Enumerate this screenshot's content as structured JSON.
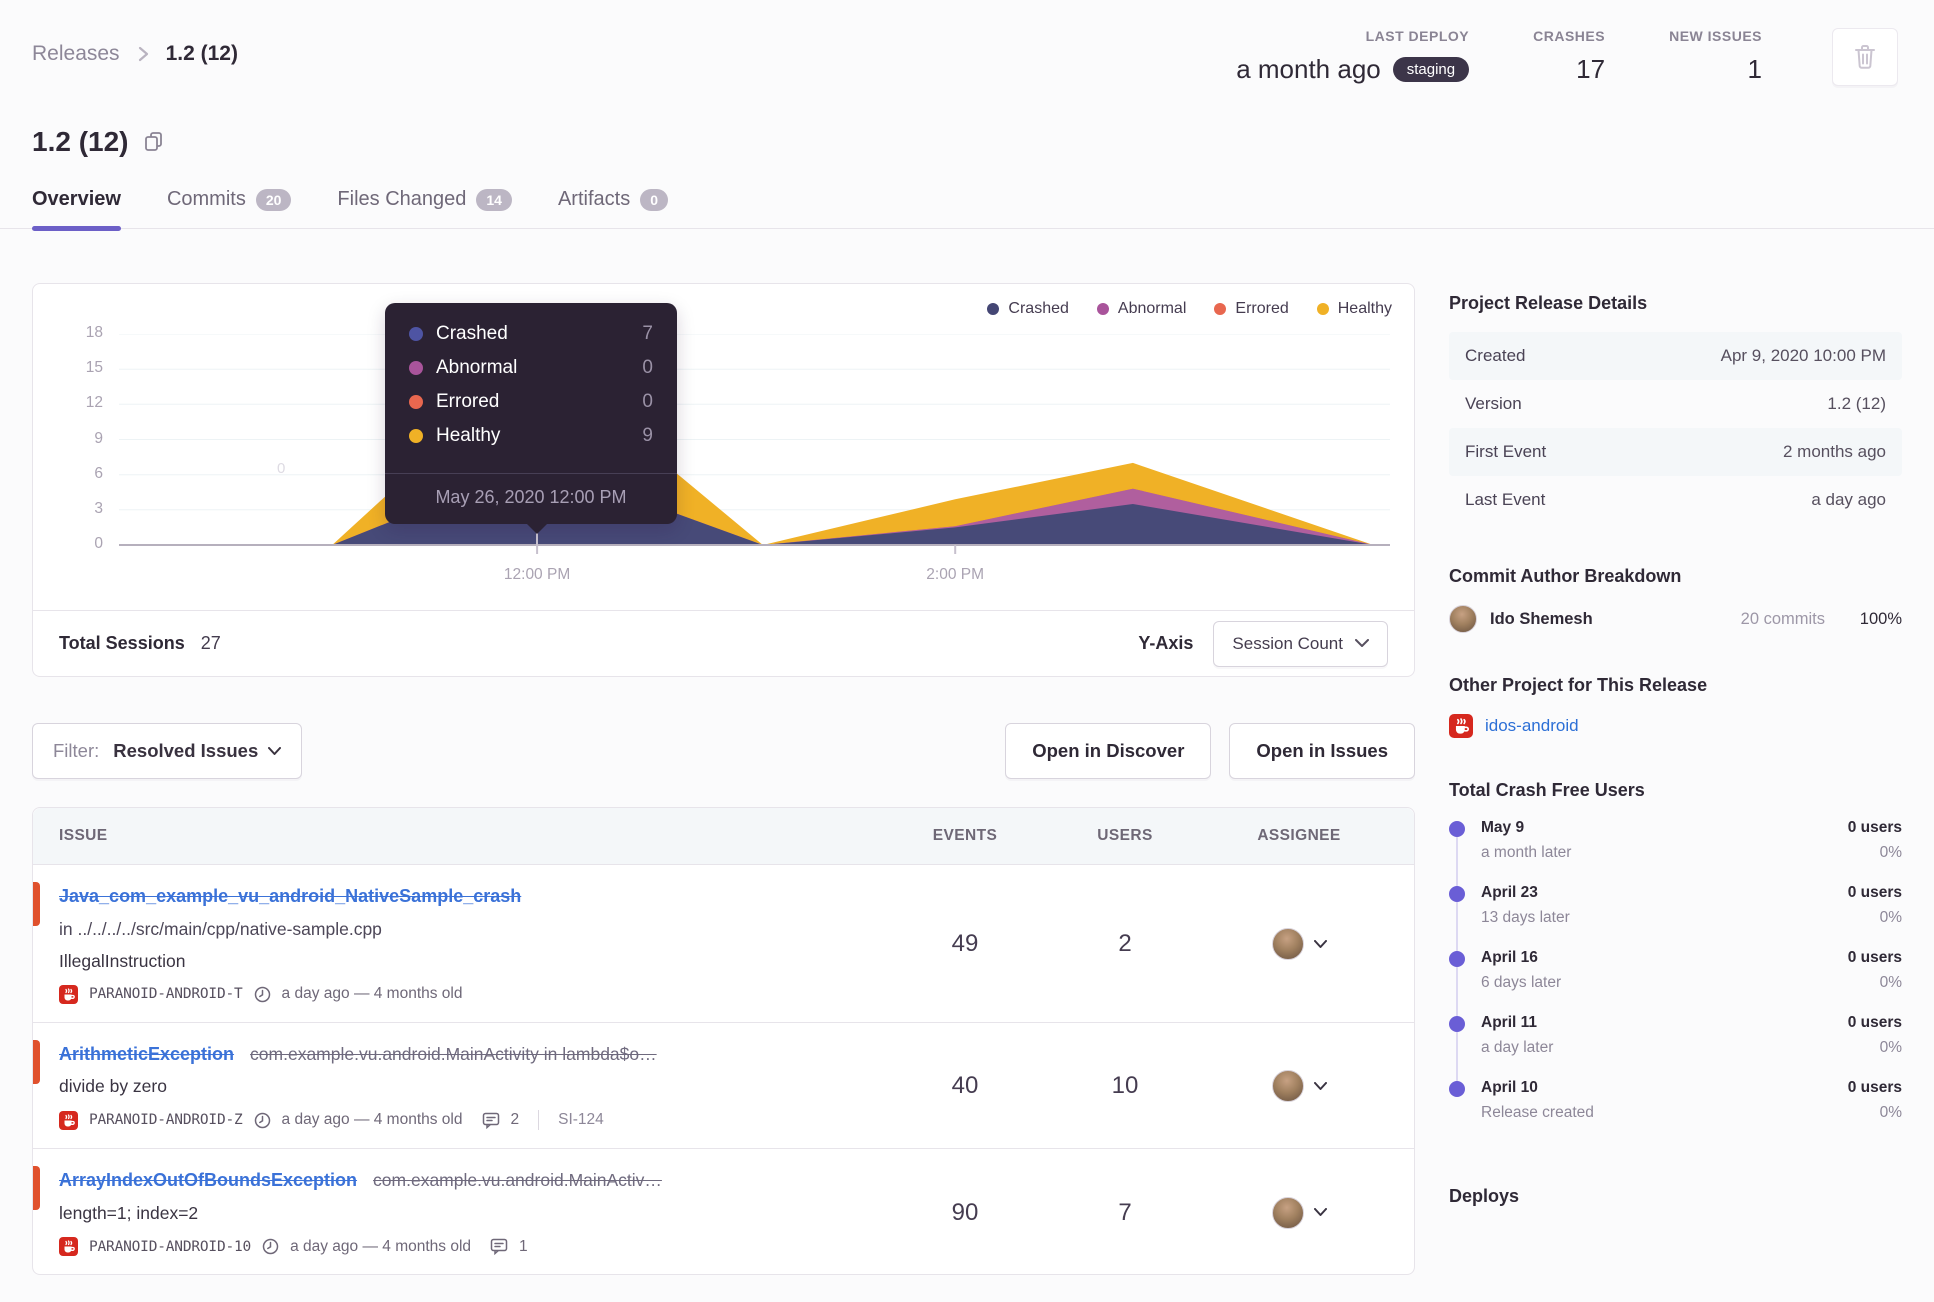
{
  "colors": {
    "accent_purple": "#6c5fc7",
    "crashed": "#444674",
    "abnormal": "#a9549b",
    "errored": "#e8674f",
    "healthy": "#f0b126",
    "error_level_bar": "#e0512d",
    "link_blue": "#3b72d8"
  },
  "breadcrumb": {
    "parent": "Releases",
    "current": "1.2 (12)"
  },
  "header": {
    "title": "1.2 (12)",
    "stats": [
      {
        "label": "LAST DEPLOY",
        "value": "a month ago",
        "badge": "staging"
      },
      {
        "label": "CRASHES",
        "value": "17"
      },
      {
        "label": "NEW ISSUES",
        "value": "1"
      }
    ]
  },
  "tabs": [
    {
      "label": "Overview"
    },
    {
      "label": "Commits",
      "badge": "20"
    },
    {
      "label": "Files Changed",
      "badge": "14"
    },
    {
      "label": "Artifacts",
      "badge": "0"
    }
  ],
  "chart": {
    "legend": [
      {
        "label": "Crashed",
        "color": "#444674"
      },
      {
        "label": "Abnormal",
        "color": "#a9549b"
      },
      {
        "label": "Errored",
        "color": "#e8674f"
      },
      {
        "label": "Healthy",
        "color": "#f0b126"
      }
    ],
    "tooltip": {
      "rows": [
        {
          "label": "Crashed",
          "value": "7",
          "color": "#4e54a3"
        },
        {
          "label": "Abnormal",
          "value": "0",
          "color": "#a9549b"
        },
        {
          "label": "Errored",
          "value": "0",
          "color": "#e8674f"
        },
        {
          "label": "Healthy",
          "value": "9",
          "color": "#f0b126"
        }
      ],
      "footer": "May 26, 2020 12:00 PM"
    },
    "y_ticks": [
      "18",
      "15",
      "12",
      "9",
      "6",
      "3",
      "0"
    ],
    "stray_zero": "0",
    "footer": {
      "sessions_label": "Total Sessions",
      "sessions_value": "27",
      "yaxis_label": "Y-Axis",
      "yaxis_value": "Session Count"
    }
  },
  "chart_data": {
    "type": "area",
    "stacked": true,
    "title": "Release sessions over time",
    "ylabel": "Session Count",
    "ylim": [
      0,
      18
    ],
    "y_ticks": [
      0,
      3,
      6,
      9,
      12,
      15,
      18
    ],
    "grid": true,
    "legend_position": "top-right",
    "t_unit": "hours after 10:00 AM, May 26 2020",
    "t_range": [
      0,
      6.08
    ],
    "x_ticks": [
      {
        "label": "12:00 PM",
        "t": 2.0
      },
      {
        "label": "2:00 PM",
        "t": 4.0
      }
    ],
    "series_order": [
      "crashed",
      "abnormal",
      "errored",
      "healthy"
    ],
    "fill_colors": {
      "crashed": "#474a78",
      "abnormal": "#b05f9e",
      "errored": "#e8674f",
      "healthy": "#f0b126"
    },
    "points": [
      {
        "t": 1.02,
        "crashed": 0,
        "abnormal": 0,
        "errored": 0,
        "healthy": 0
      },
      {
        "t": 2.0,
        "crashed": 7,
        "abnormal": 0,
        "errored": 0,
        "healthy": 9
      },
      {
        "t": 3.08,
        "crashed": 0,
        "abnormal": 0,
        "errored": 0,
        "healthy": 0
      },
      {
        "t": 4.0,
        "crashed": 1.5,
        "abnormal": 0.1,
        "errored": 0,
        "healthy": 2.3
      },
      {
        "t": 4.85,
        "crashed": 3.5,
        "abnormal": 1.3,
        "errored": 0,
        "healthy": 2.2
      },
      {
        "t": 6.0,
        "crashed": 0,
        "abnormal": 0,
        "errored": 0,
        "healthy": 0
      }
    ],
    "highlighted_point": {
      "time": "May 26, 2020 12:00 PM",
      "crashed": 7,
      "abnormal": 0,
      "errored": 0,
      "healthy": 9
    },
    "total_sessions": 27
  },
  "controls": {
    "filter_label": "Filter:",
    "filter_value": "Resolved Issues",
    "open_discover": "Open in Discover",
    "open_issues": "Open in Issues"
  },
  "issues": {
    "columns": [
      "ISSUE",
      "EVENTS",
      "USERS",
      "ASSIGNEE"
    ],
    "rows": [
      {
        "title": "Java_com_example_vu_android_NativeSample_crash",
        "path": "in ../../../../src/main/cpp/native-sample.cpp",
        "culprit": "IllegalInstruction",
        "project": "PARANOID-ANDROID-T",
        "age": "a day ago — 4 months old",
        "events": "49",
        "users": "2"
      },
      {
        "title": "ArithmeticException",
        "subtitle": "com.example.vu.android.MainActivity in lambda$o…",
        "culprit": "divide by zero",
        "project": "PARANOID-ANDROID-Z",
        "age": "a day ago — 4 months old",
        "comments": "2",
        "short_id": "SI-124",
        "events": "40",
        "users": "10"
      },
      {
        "title": "ArrayIndexOutOfBoundsException",
        "subtitle": "com.example.vu.android.MainActiv…",
        "culprit": "length=1; index=2",
        "project": "PARANOID-ANDROID-10",
        "age": "a day ago — 4 months old",
        "comments": "1",
        "events": "90",
        "users": "7"
      }
    ]
  },
  "sidebar": {
    "release_details": {
      "heading": "Project Release Details",
      "rows": [
        [
          "Created",
          "Apr 9, 2020 10:00 PM"
        ],
        [
          "Version",
          "1.2 (12)"
        ],
        [
          "First Event",
          "2 months ago"
        ],
        [
          "Last Event",
          "a day ago"
        ]
      ]
    },
    "authors": {
      "heading": "Commit Author Breakdown",
      "name": "Ido Shemesh",
      "commits": "20 commits",
      "percent": "100%"
    },
    "other_project": {
      "heading": "Other Project for This Release",
      "project": "idos-android"
    },
    "crash_free": {
      "heading": "Total Crash Free Users",
      "items": [
        {
          "date": "May 9",
          "sub": "a month later",
          "users": "0 users",
          "percent": "0%"
        },
        {
          "date": "April 23",
          "sub": "13 days later",
          "users": "0 users",
          "percent": "0%"
        },
        {
          "date": "April 16",
          "sub": "6 days later",
          "users": "0 users",
          "percent": "0%"
        },
        {
          "date": "April 11",
          "sub": "a day later",
          "users": "0 users",
          "percent": "0%"
        },
        {
          "date": "April 10",
          "sub": "Release created",
          "users": "0 users",
          "percent": "0%"
        }
      ]
    },
    "deploys_heading": "Deploys"
  }
}
